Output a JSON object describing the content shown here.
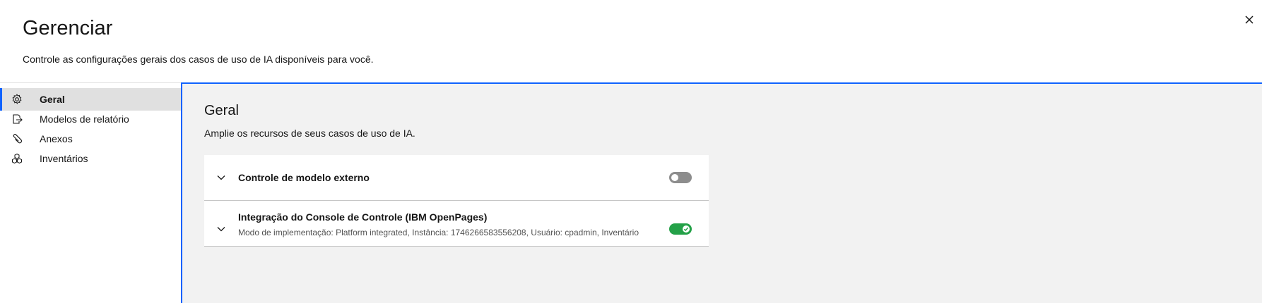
{
  "header": {
    "title": "Gerenciar",
    "subtitle": "Controle as configurações gerais dos casos de uso de IA disponíveis para você.",
    "close_icon": "close-icon"
  },
  "sidebar": {
    "items": [
      {
        "label": "Geral",
        "icon": "settings-icon",
        "active": true
      },
      {
        "label": "Modelos de relatório",
        "icon": "document-export-icon",
        "active": false
      },
      {
        "label": "Anexos",
        "icon": "attachment-icon",
        "active": false
      },
      {
        "label": "Inventários",
        "icon": "inventory-icon",
        "active": false
      }
    ]
  },
  "main": {
    "title": "Geral",
    "description": "Amplie os recursos de seus casos de uso de IA.",
    "settings": [
      {
        "title": "Controle de modelo externo",
        "detail": "",
        "enabled": false
      },
      {
        "title": "Integração do Console de Controle (IBM OpenPages)",
        "detail": "Modo de implementação: Platform integrated, Instância: 1746266583556208, Usuário: cpadmin, Inventário",
        "enabled": true
      }
    ]
  },
  "colors": {
    "accent": "#0f62fe",
    "toggle_on": "#24a148",
    "toggle_off": "#8d8d8d",
    "panel_bg": "#f2f2f2",
    "active_nav_bg": "#e0e0e0"
  }
}
